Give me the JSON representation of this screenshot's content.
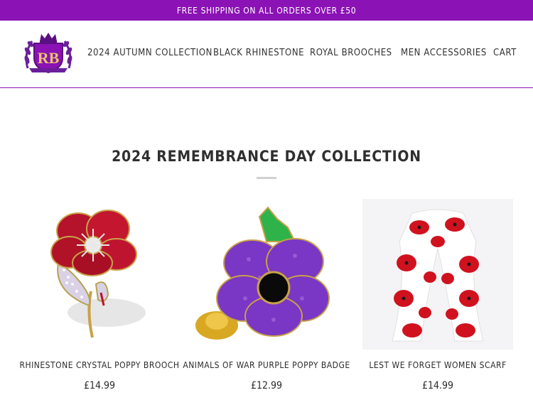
{
  "announcement": "FREE SHIPPING ON ALL ORDERS OVER £50",
  "brand": {
    "logo_icon": "royal-crest-logo",
    "monogram": "RB",
    "colors": {
      "primary": "#8b12b4",
      "crown": "#5a1080"
    }
  },
  "nav": {
    "items": [
      {
        "label": "2024 AUTUMN COLLECTION"
      },
      {
        "label": "BLACK RHINESTONE"
      },
      {
        "label": "ROYAL BROOCHES"
      },
      {
        "label": "MEN ACCESSORIES"
      },
      {
        "label": "CART"
      }
    ]
  },
  "collection": {
    "title": "2024 REMEMBRANCE DAY COLLECTION",
    "products": [
      {
        "name": "RHINESTONE CRYSTAL POPPY BROOCH",
        "price": "£14.99",
        "image_icon": "red-poppy-brooch"
      },
      {
        "name": "ANIMALS OF WAR PURPLE POPPY BADGE",
        "price": "£12.99",
        "image_icon": "purple-poppy-badge"
      },
      {
        "name": "LEST WE FORGET WOMEN SCARF",
        "price": "£14.99",
        "image_icon": "poppy-scarf"
      }
    ]
  }
}
